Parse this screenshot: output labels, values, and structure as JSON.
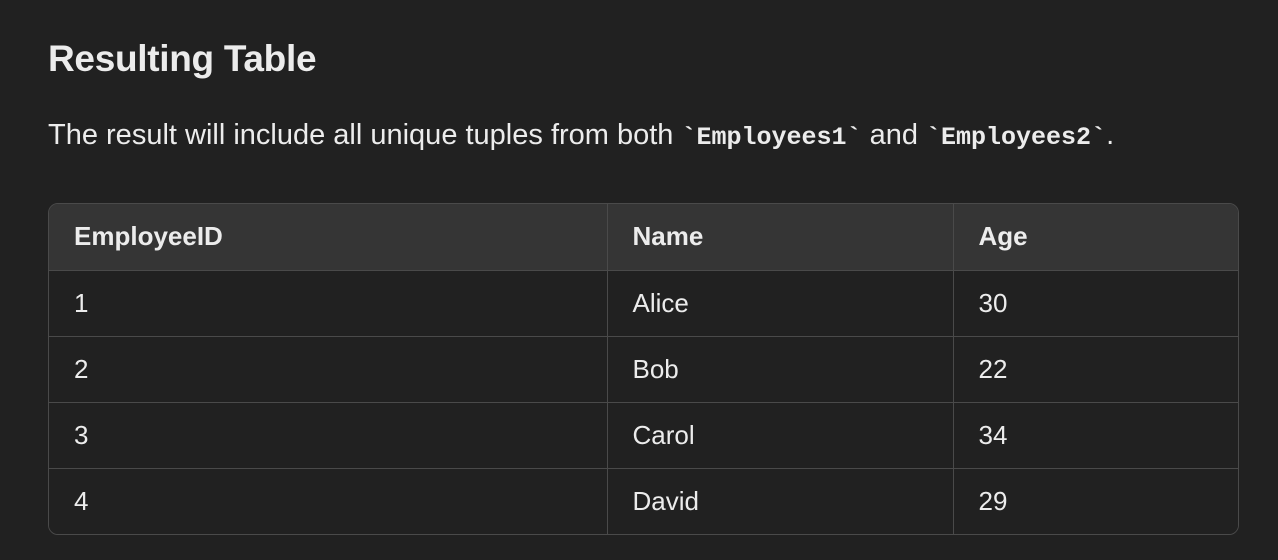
{
  "heading": "Resulting Table",
  "paragraph": {
    "before": "The result will include all unique tuples from both ",
    "code1": "`Employees1`",
    "middle": " and ",
    "code2": "`Employees2`",
    "after": "."
  },
  "table": {
    "headers": [
      "EmployeeID",
      "Name",
      "Age"
    ],
    "rows": [
      [
        "1",
        "Alice",
        "30"
      ],
      [
        "2",
        "Bob",
        "22"
      ],
      [
        "3",
        "Carol",
        "34"
      ],
      [
        "4",
        "David",
        "29"
      ]
    ]
  },
  "colors": {
    "background": "#212121",
    "header_background": "#353535",
    "border": "#4a4a4a",
    "text": "#ececec"
  }
}
